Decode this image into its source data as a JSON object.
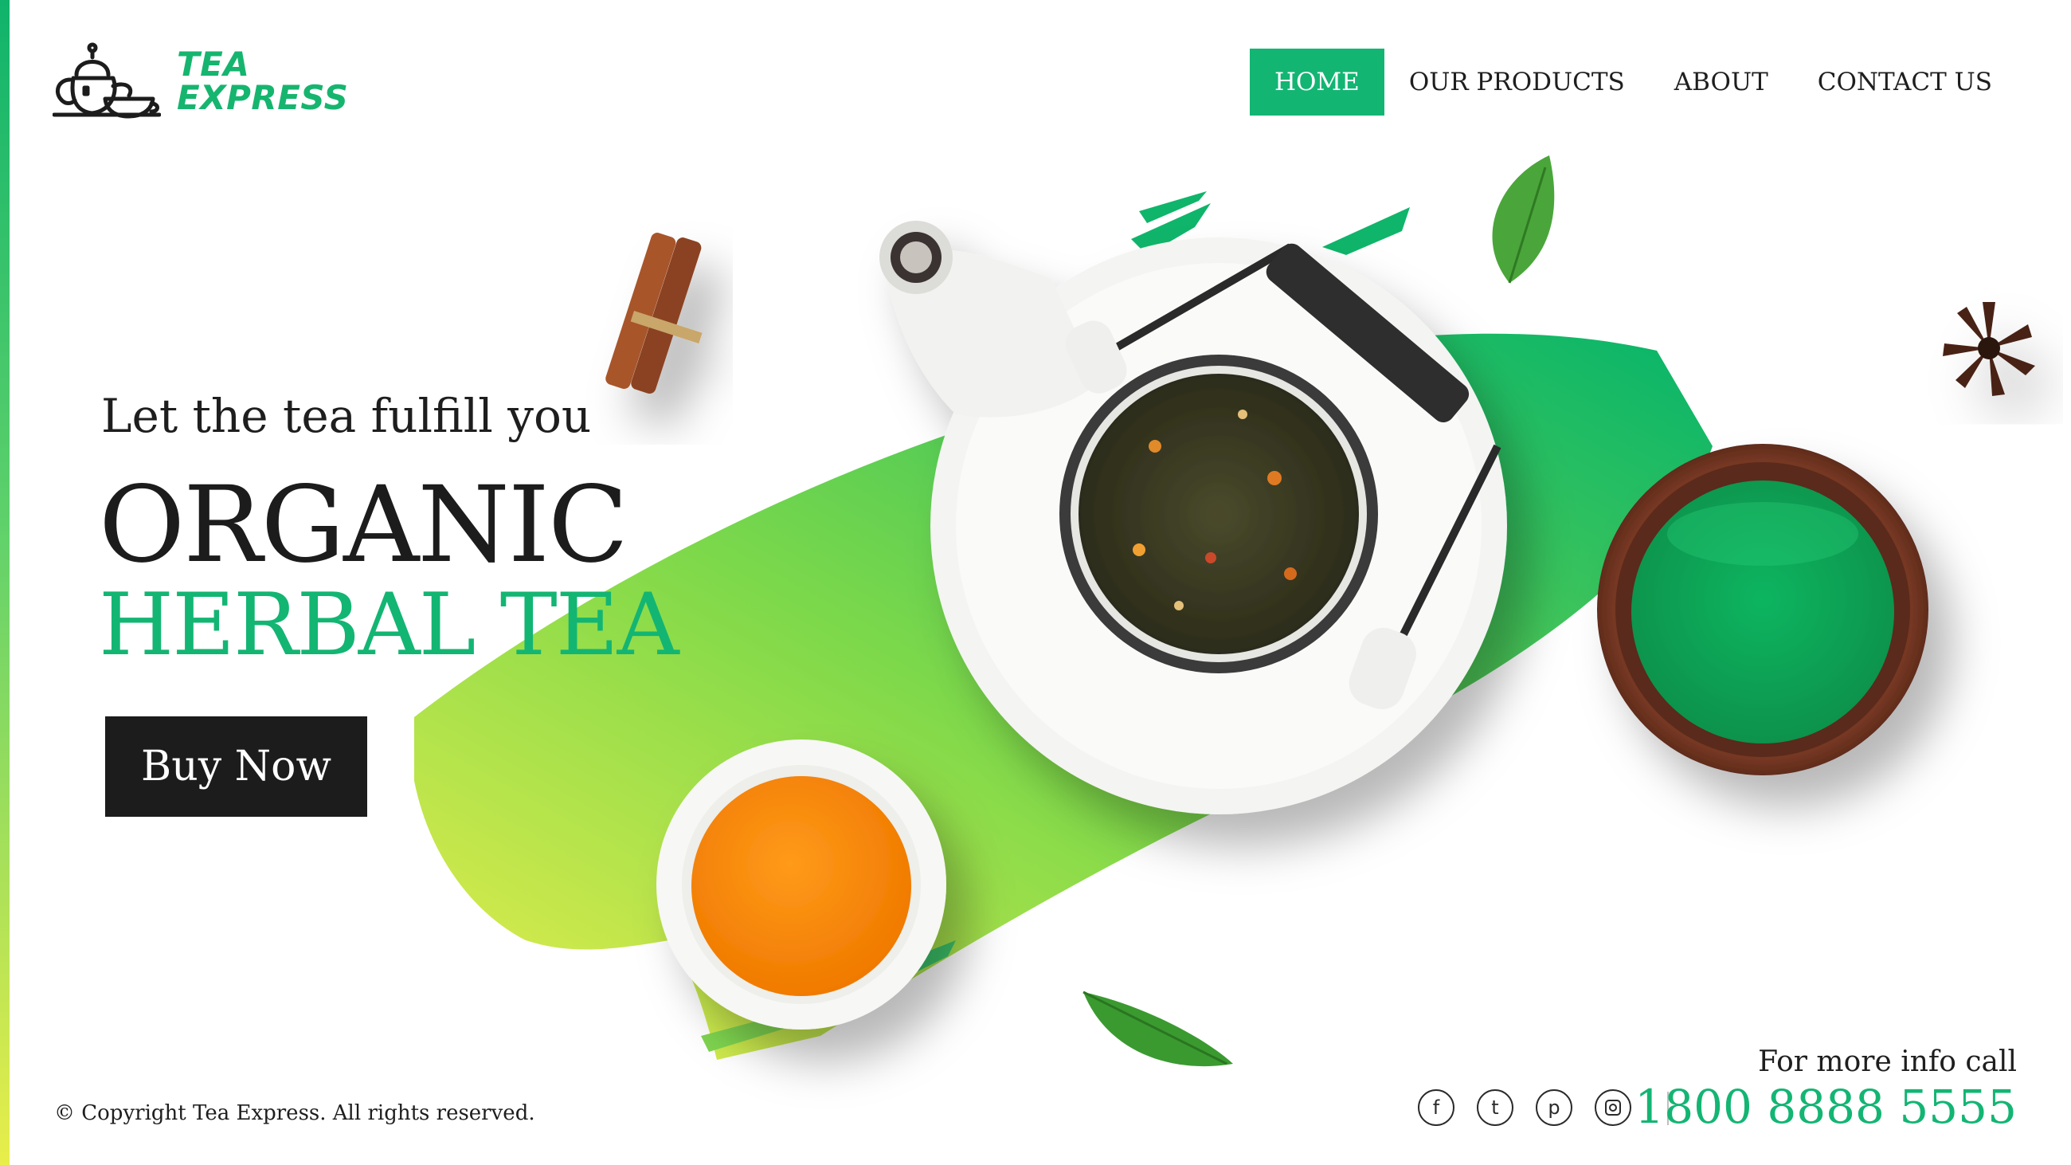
{
  "brand": {
    "name_line1": "TEA",
    "name_line2": "EXPRESS",
    "logo_icon": "teapot-icon",
    "color": "#13b573"
  },
  "nav": {
    "items": [
      {
        "label": "HOME",
        "active": true
      },
      {
        "label": "OUR PRODUCTS",
        "active": false
      },
      {
        "label": "ABOUT",
        "active": false
      },
      {
        "label": "CONTACT US",
        "active": false
      }
    ]
  },
  "hero": {
    "tagline": "Let the tea fulfill you",
    "headline_line1": "ORGANIC",
    "headline_line2": "HERBAL TEA",
    "cta_label": "Buy Now"
  },
  "footer": {
    "copyright": "© Copyright Tea Express. All rights reserved.",
    "info_label": "For more info call",
    "phone": "1800 8888 5555",
    "social_icons": [
      "facebook-icon",
      "twitter-icon",
      "pinterest-icon",
      "instagram-icon"
    ]
  },
  "colors": {
    "accent": "#13b573",
    "dark": "#1c1c1c",
    "brush_start": "#e8ee4a",
    "brush_end": "#10b86a"
  }
}
